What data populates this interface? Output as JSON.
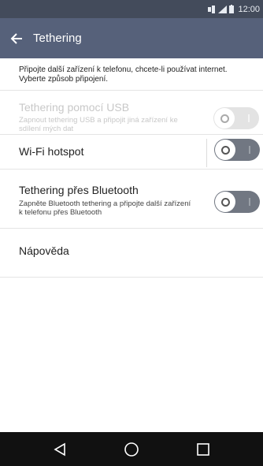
{
  "status_bar": {
    "time": "12:00",
    "icons": [
      "data-icon",
      "signal-icon",
      "battery-icon"
    ]
  },
  "app_bar": {
    "title": "Tethering",
    "back_icon": "arrow-left-icon"
  },
  "intro_text": "Připojte další zařízení k telefonu, chcete-li používat internet. Vyberte způsob připojení.",
  "settings": {
    "usb": {
      "label": "Tethering pomocí USB",
      "description": "Zapnout tethering USB a připojit jiná zařízení ke sdílení mých dat",
      "enabled": false,
      "on": false
    },
    "wifi": {
      "label": "Wi-Fi hotspot",
      "enabled": true,
      "on": false
    },
    "bluetooth": {
      "label": "Tethering přes Bluetooth",
      "description": "Zapněte Bluetooth tethering a připojte další zařízení k telefonu přes Bluetooth",
      "enabled": true,
      "on": false
    },
    "help": {
      "label": "Nápověda"
    }
  },
  "colors": {
    "status_bar": "#434b5b",
    "app_bar": "#56617a",
    "toggle_off": "#717782",
    "toggle_disabled": "#e3e3e3",
    "nav_bar": "#111111"
  },
  "nav_bar": {
    "icons": [
      "back-triangle-icon",
      "home-circle-icon",
      "recents-square-icon"
    ]
  }
}
